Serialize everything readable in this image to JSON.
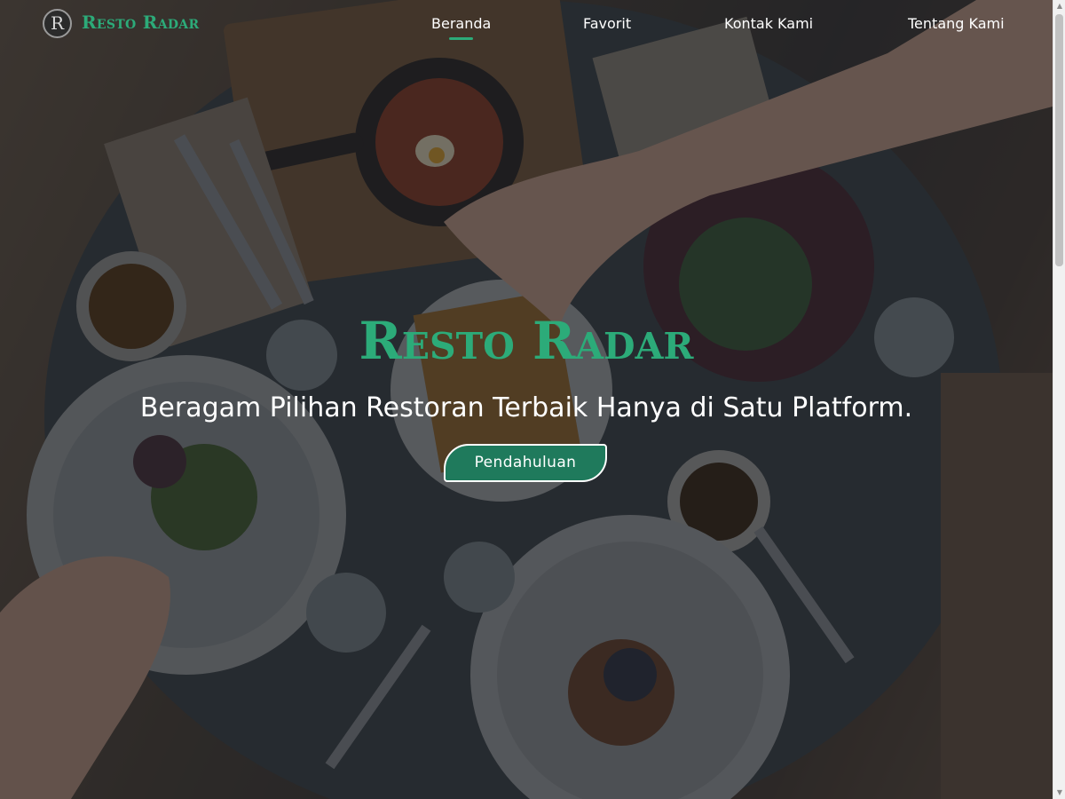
{
  "header": {
    "logo_letter": "R",
    "brand": "Resto Radar"
  },
  "nav": {
    "items": [
      {
        "label": "Beranda",
        "active": true
      },
      {
        "label": "Favorit",
        "active": false
      },
      {
        "label": "Kontak Kami",
        "active": false
      },
      {
        "label": "Tentang Kami",
        "active": false
      }
    ]
  },
  "hero": {
    "title": "Resto Radar",
    "subtitle": "Beragam Pilihan Restoran Terbaik Hanya di Satu Platform.",
    "button_label": "Pendahuluan"
  },
  "theme": {
    "accent": "#2cab79",
    "button": "#1f7a5c",
    "text": "#ffffff"
  },
  "icons": {
    "logo": "letter-r-circle-icon",
    "scroll_up": "triangle-up-icon",
    "scroll_down": "triangle-down-icon"
  }
}
